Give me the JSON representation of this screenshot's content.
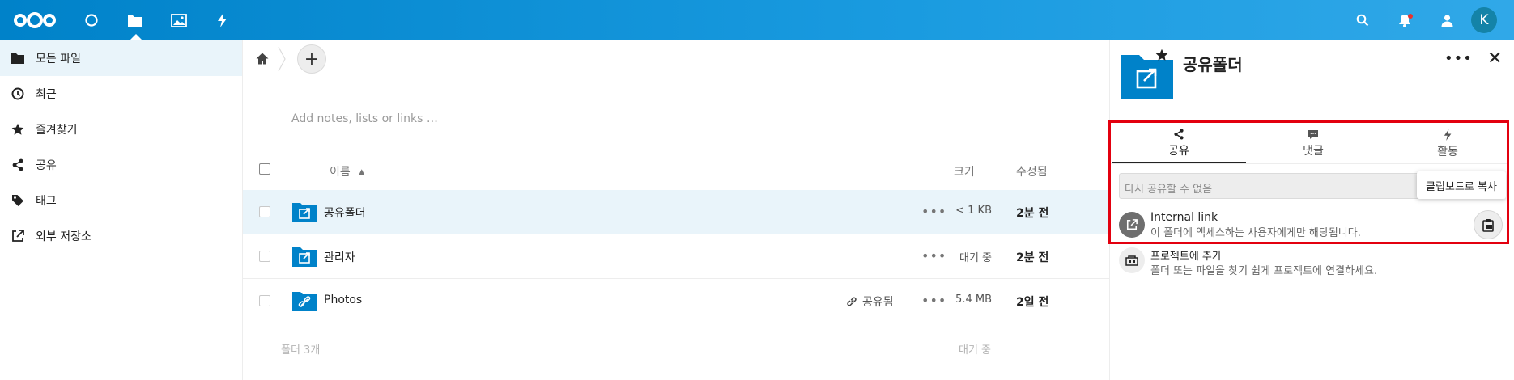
{
  "header": {
    "apps": [
      "dashboard-icon",
      "files-icon",
      "photos-icon",
      "activity-icon"
    ],
    "right_icons": [
      "search-icon",
      "notifications-icon",
      "contacts-icon"
    ],
    "avatar_letter": "K",
    "brand_color": "#0082c9"
  },
  "nav": {
    "items": [
      {
        "label": "모든 파일",
        "icon": "folder-icon"
      },
      {
        "label": "최근",
        "icon": "clock-icon"
      },
      {
        "label": "즐겨찾기",
        "icon": "star-icon"
      },
      {
        "label": "공유",
        "icon": "share-icon"
      },
      {
        "label": "태그",
        "icon": "tag-icon"
      },
      {
        "label": "외부 저장소",
        "icon": "external-icon"
      }
    ]
  },
  "main": {
    "add_label": "+",
    "notes_placeholder": "Add notes, lists or links …",
    "columns": {
      "name": "이름",
      "size": "크기",
      "modified": "수정됨"
    },
    "files": [
      {
        "name": "공유폴더",
        "size": "< 1 KB",
        "modified": "2분 전",
        "shared": ""
      },
      {
        "name": "관리자",
        "size": "대기 중",
        "modified": "2분 전",
        "shared": ""
      },
      {
        "name": "Photos",
        "size": "5.4 MB",
        "modified": "2일 전",
        "shared": "공유됨"
      }
    ],
    "summary_count": "폴더 3개",
    "summary_size": "대기 중"
  },
  "sidebar": {
    "title": "공유폴더",
    "tabs": [
      {
        "label": "공유",
        "icon": "share-icon"
      },
      {
        "label": "댓글",
        "icon": "comment-icon"
      },
      {
        "label": "활동",
        "icon": "activity-icon"
      }
    ],
    "reshare_text": "다시 공유할 수 없음",
    "tooltip": "클립보드로 복사",
    "internal_link_title": "Internal link",
    "internal_link_sub": "이 폴더에 액세스하는 사용자에게만 해당됩니다.",
    "project_title": "프로젝트에 추가",
    "project_sub": "폴더 또는 파일을 찾기 쉽게 프로젝트에 연결하세요."
  }
}
